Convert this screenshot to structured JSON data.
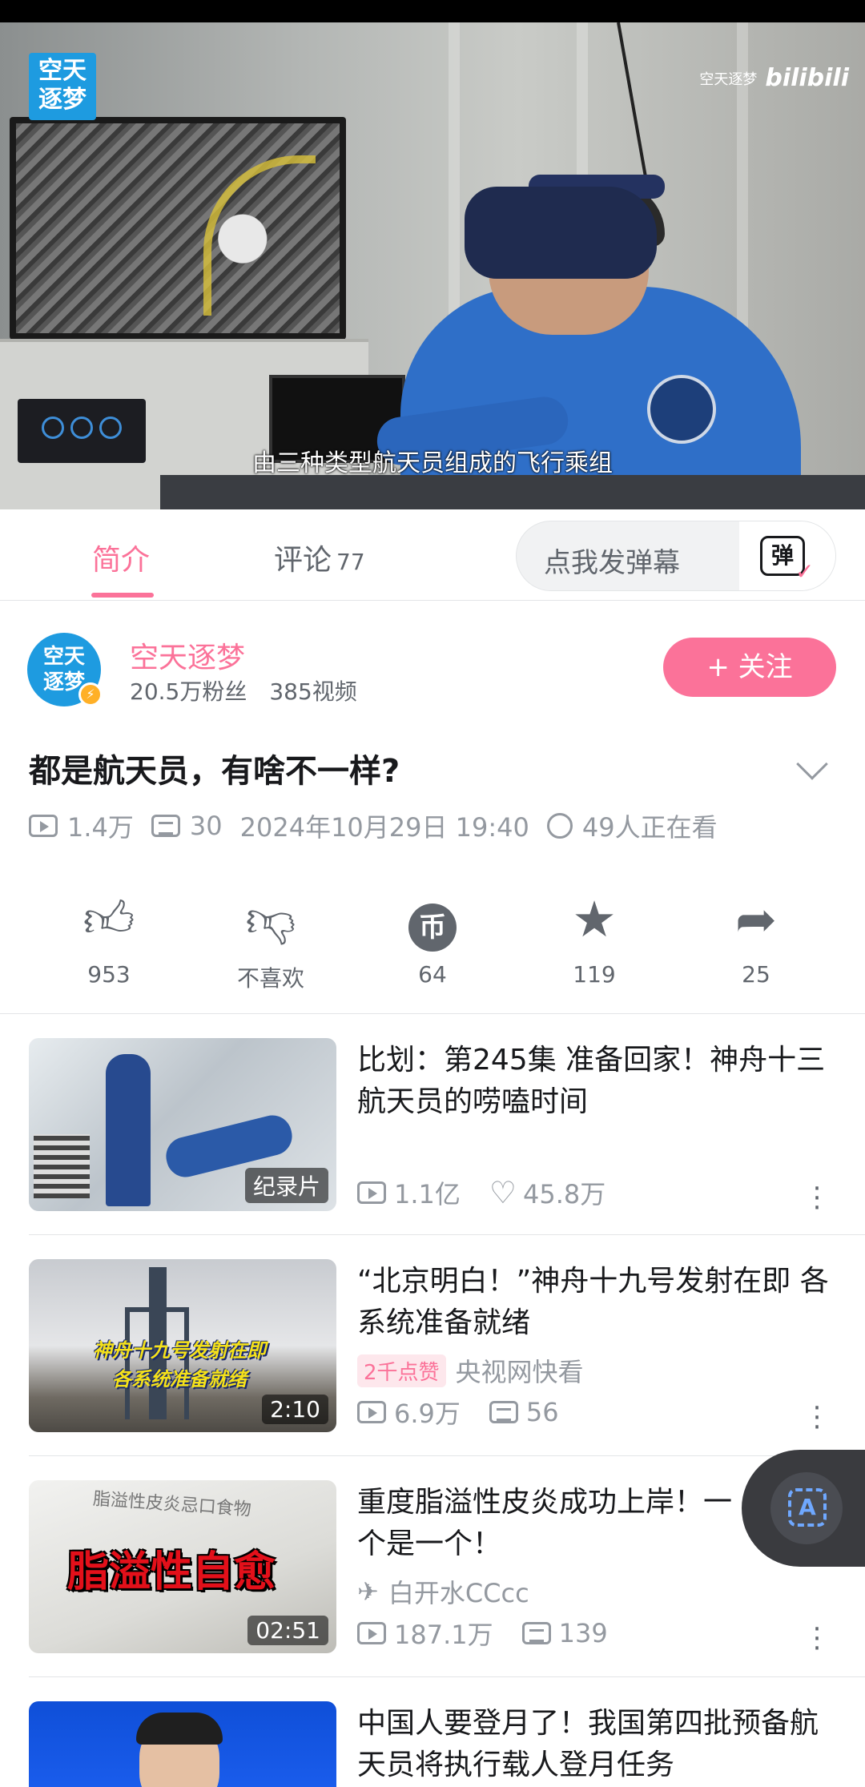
{
  "player": {
    "channel_logo_line1": "空天",
    "channel_logo_line2": "逐梦",
    "watermark_channel": "空天逐梦",
    "watermark_brand": "bilibili",
    "subtitle": "由三种类型航天员组成的飞行乘组",
    "accent": "#fb7299"
  },
  "tabs": {
    "intro": "简介",
    "comments": "评论",
    "comments_count": "77",
    "danmaku_placeholder": "点我发弹幕",
    "danmaku_icon": "弹"
  },
  "uploader": {
    "avatar_line1": "空天",
    "avatar_line2": "逐梦",
    "name": "空天逐梦",
    "fans": "20.5万粉丝",
    "videos": "385视频",
    "follow_label": "+ 关注"
  },
  "video": {
    "title": "都是航天员，有啥不一样?",
    "views": "1.4万",
    "danmaku": "30",
    "date": "2024年10月29日 19:40",
    "watching": "49人正在看"
  },
  "actions": {
    "like": {
      "icon": "thumbs-up-icon",
      "label": "953"
    },
    "dislike": {
      "icon": "thumbs-down-icon",
      "label": "不喜欢"
    },
    "coin": {
      "icon": "coin-icon",
      "glyph": "币",
      "label": "64"
    },
    "favorite": {
      "icon": "star-icon",
      "label": "119"
    },
    "share": {
      "icon": "share-icon",
      "label": "25"
    }
  },
  "recommendations": [
    {
      "title": "比划：第245集 准备回家！神舟十三航天员的唠嗑时间",
      "badge": "纪录片",
      "views": "1.1亿",
      "likes": "45.8万"
    },
    {
      "title": "“北京明白！”神舟十九号发射在即 各系统准备就绪",
      "thumb_caption_1": "神舟十九号发射在即",
      "thumb_caption_2": "各系统准备就绪",
      "badge": "2:10",
      "hot_tag": "2千点赞",
      "author": "央视网快看",
      "views": "6.9万",
      "danmaku": "56"
    },
    {
      "title": "重度脂溢性皮炎成功上岸！一个是一个！",
      "thumb_small": "脂溢性皮炎忌口食物",
      "thumb_big": "脂溢性自愈",
      "badge": "02:51",
      "author": "白开水CCcc",
      "views": "187.1万",
      "danmaku": "139"
    },
    {
      "title": "中国人要登月了！我国第四批预备航天员将执行载人登月任务"
    }
  ],
  "fab": {
    "icon": "translate-icon",
    "glyph": "A"
  }
}
